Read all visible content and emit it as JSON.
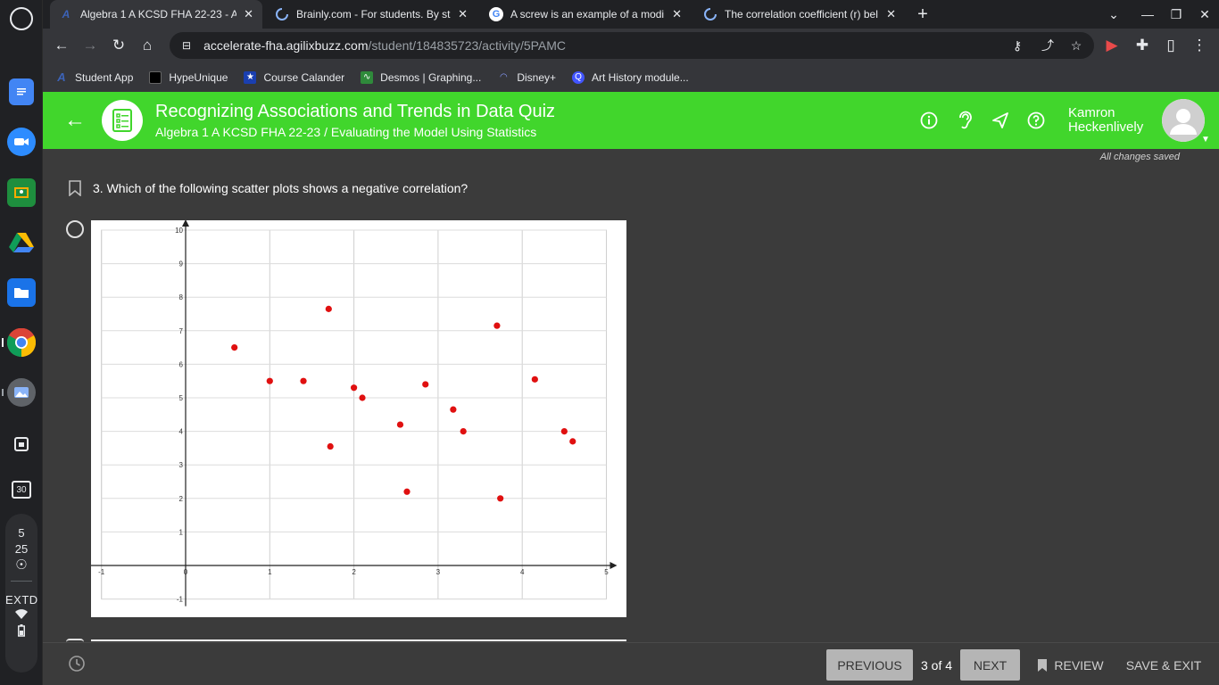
{
  "browser": {
    "tabs": [
      {
        "title": "Algebra 1 A KCSD FHA 22-23 - A",
        "favicon": "agilix-icon",
        "active": true
      },
      {
        "title": "Brainly.com - For students. By st",
        "favicon": "loading-icon",
        "active": false
      },
      {
        "title": "A screw is an example of a modi",
        "favicon": "google-icon",
        "active": false
      },
      {
        "title": "The correlation coefficient (r) bel",
        "favicon": "loading-icon",
        "active": false
      }
    ],
    "url_host": "accelerate-fha.agilixbuzz.com",
    "url_path": "/student/184835723/activity/5PAMC",
    "bookmarks": [
      {
        "label": "Student App",
        "icon": "agilix-icon",
        "color": "#3c63b8"
      },
      {
        "label": "HypeUnique",
        "icon": "hype-icon",
        "color": "#000000"
      },
      {
        "label": "Course Calander",
        "icon": "star-icon",
        "color": "#1a3fb0"
      },
      {
        "label": "Desmos | Graphing...",
        "icon": "desmos-icon",
        "color": "#2f8a3b"
      },
      {
        "label": "Disney+",
        "icon": "disney-icon",
        "color": "#1a2b6b"
      },
      {
        "label": "Art History module...",
        "icon": "quizlet-icon",
        "color": "#4255ff"
      }
    ]
  },
  "shelf": {
    "date_top": "5",
    "date_bottom": "25",
    "extd_label": "EXTD",
    "calendar_day": "30"
  },
  "header": {
    "title": "Recognizing Associations and Trends in Data Quiz",
    "subtitle": "Algebra 1 A KCSD FHA 22-23 / Evaluating the Model Using Statistics",
    "user_first": "Kamron",
    "user_last": "Heckenlively",
    "accent_color": "#41d62c"
  },
  "status": {
    "saved": "All changes saved"
  },
  "question": {
    "text": "3. Which of the following scatter plots shows a negative correlation?"
  },
  "chart_data": {
    "type": "scatter",
    "title": "",
    "xlabel": "",
    "ylabel": "",
    "xlim": [
      -1,
      5
    ],
    "ylim": [
      -1,
      10
    ],
    "x_ticks": [
      "-1",
      "0",
      "1",
      "2",
      "3",
      "4",
      "5"
    ],
    "y_ticks": [
      "-1",
      "1",
      "2",
      "3",
      "4",
      "5",
      "6",
      "7",
      "8",
      "9",
      "10"
    ],
    "grid": true,
    "series": [
      {
        "color": "#e01010",
        "points": [
          [
            0.58,
            6.5
          ],
          [
            1.0,
            5.5
          ],
          [
            1.4,
            5.5
          ],
          [
            1.7,
            7.65
          ],
          [
            1.72,
            3.55
          ],
          [
            2.0,
            5.3
          ],
          [
            2.1,
            5.0
          ],
          [
            2.55,
            4.2
          ],
          [
            2.63,
            2.2
          ],
          [
            2.85,
            5.4
          ],
          [
            3.18,
            4.65
          ],
          [
            3.3,
            4.0
          ],
          [
            3.7,
            7.15
          ],
          [
            3.74,
            2.0
          ],
          [
            4.15,
            5.55
          ],
          [
            4.5,
            4.0
          ],
          [
            4.6,
            3.7
          ]
        ]
      }
    ]
  },
  "footer": {
    "previous": "PREVIOUS",
    "page_count": "3 of 4",
    "next": "NEXT",
    "review": "REVIEW",
    "save_exit": "SAVE & EXIT"
  }
}
